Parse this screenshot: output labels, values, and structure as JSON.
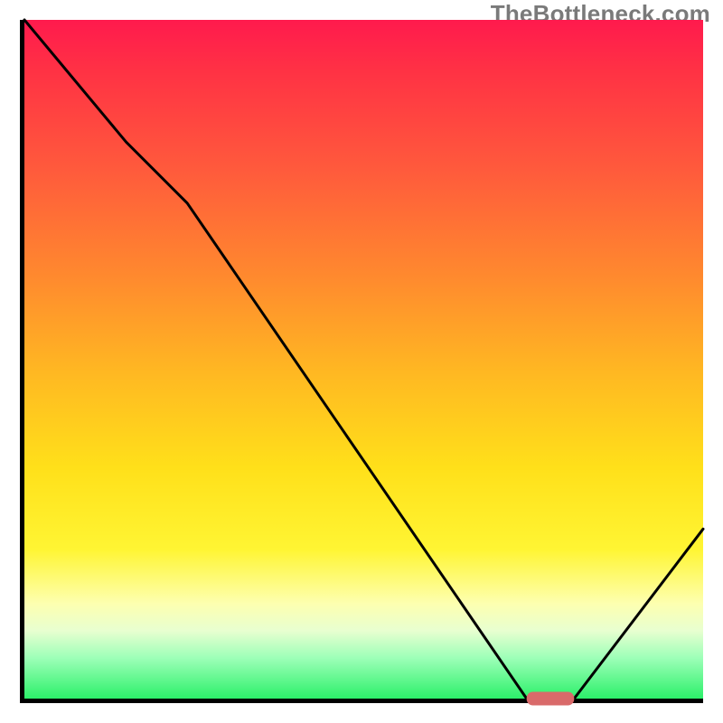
{
  "watermark": "TheBottleneck.com",
  "chart_data": {
    "type": "line",
    "x": [
      0,
      15,
      24,
      74,
      81,
      100
    ],
    "values": [
      100,
      82,
      73,
      0,
      0,
      25
    ],
    "title": "",
    "xlabel": "",
    "ylabel": "",
    "xlim": [
      0,
      100
    ],
    "ylim": [
      0,
      100
    ],
    "optimal_segment": {
      "x_start": 74,
      "x_end": 81,
      "y": 0
    },
    "background_gradient": {
      "top": "#ff1a4d",
      "mid_upper": "#ff8a2e",
      "mid": "#ffe01a",
      "mid_lower": "#fdffb0",
      "bottom": "#2cf06a"
    },
    "marker_color": "#d96a6a"
  }
}
